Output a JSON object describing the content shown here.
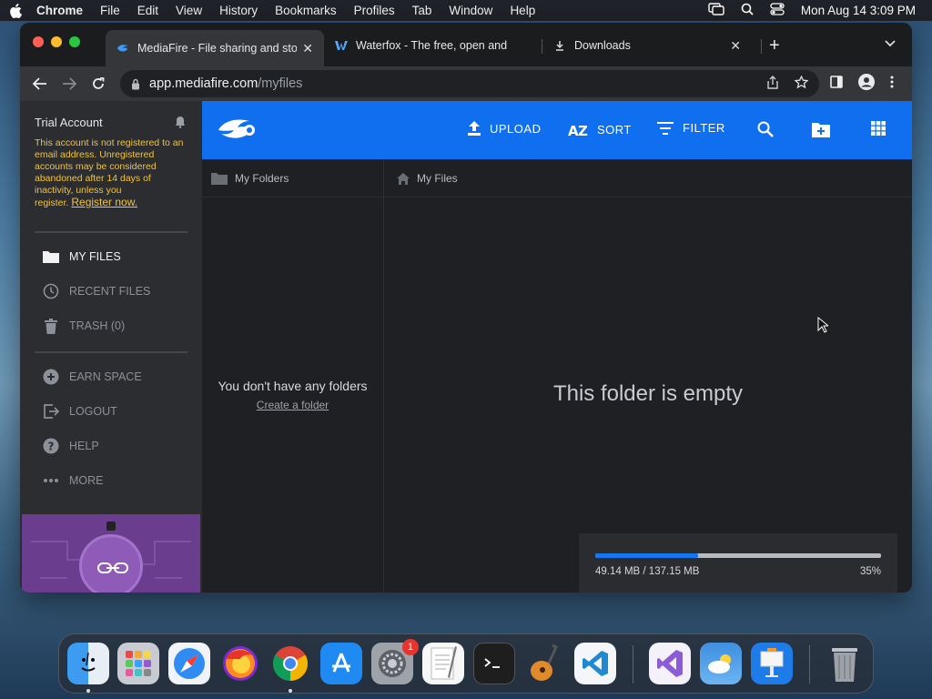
{
  "menubar": {
    "app": "Chrome",
    "items": [
      "File",
      "Edit",
      "View",
      "History",
      "Bookmarks",
      "Profiles",
      "Tab",
      "Window",
      "Help"
    ],
    "clock": "Mon Aug 14  3:09 PM"
  },
  "tabs": [
    {
      "title": "MediaFire - File sharing and storage",
      "icon": "mediafire-icon"
    },
    {
      "title": "Waterfox - The free, open and private",
      "icon": "waterfox-icon"
    },
    {
      "title": "Downloads",
      "icon": "download-icon"
    }
  ],
  "address": {
    "host": "app.mediafire.com",
    "path": "/myfiles"
  },
  "sidebar": {
    "account_title": "Trial Account",
    "warning": "This account is not registered to an email address. Unregistered accounts may be considered abandoned after 14 days of inactivity, unless you register.",
    "register_link": "Register now.",
    "nav": [
      {
        "label": "MY FILES",
        "icon": "folder-icon"
      },
      {
        "label": "RECENT FILES",
        "icon": "clock-icon"
      },
      {
        "label": "TRASH (0)",
        "icon": "trash-icon"
      }
    ],
    "nav2": [
      {
        "label": "EARN SPACE",
        "icon": "plus-circle-icon"
      },
      {
        "label": "LOGOUT",
        "icon": "logout-icon"
      },
      {
        "label": "HELP",
        "icon": "help-icon"
      },
      {
        "label": "MORE",
        "icon": "more-icon"
      }
    ]
  },
  "topbar": {
    "upload": "UPLOAD",
    "sort": "SORT",
    "filter": "FILTER",
    "accent": "#0f6fee"
  },
  "folders_panel": {
    "title": "My Folders",
    "empty_text": "You don't have any folders",
    "create_link": "Create a folder"
  },
  "files_panel": {
    "title": "My Files",
    "empty_text": "This folder is empty"
  },
  "storage": {
    "used_text": "49.14 MB / 137.15 MB",
    "percent_text": "35%",
    "fraction": 0.36
  },
  "dock": {
    "apps": [
      "Finder",
      "Launchpad",
      "Safari",
      "Firefox",
      "Chrome",
      "App Store",
      "System Settings",
      "TextEdit",
      "Terminal",
      "GarageBand",
      "VS Code",
      "Visual Studio",
      "Weather",
      "Keynote",
      "Trash"
    ],
    "settings_badge": "1"
  }
}
